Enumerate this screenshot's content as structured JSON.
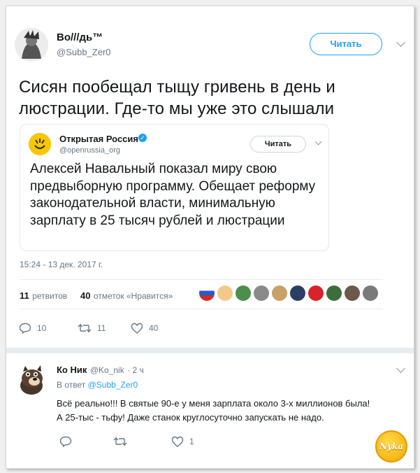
{
  "tweet": {
    "author_name": "Во///дь™",
    "author_handle": "@Subb_Zer0",
    "follow_label": "Читать",
    "text": "Сисян пообещал тыщу гривень в день и люстрации. Где-то мы уже это слышали",
    "timestamp": "15:24 - 13 дек. 2017 г.",
    "retweets_count": "11",
    "retweets_label": "ретвитов",
    "likes_count": "40",
    "likes_label": "отметок «Нравится»",
    "action_reply_count": "10",
    "action_retweet_count": "11",
    "action_like_count": "40"
  },
  "quoted": {
    "author_name": "Открытая Россия",
    "author_handle": "@openrussia_org",
    "follow_label": "Читать",
    "text": "Алексей Навальный показал миру свою предвыборную программу. Обещает реформу законодательной власти, минимальную зарплату в 25 тысяч рублей и люстрации"
  },
  "reply": {
    "author_name": "Ко Ник",
    "author_handle": "@Ko_nik",
    "age": "· 2 ч",
    "in_reply_prefix": "В ответ",
    "in_reply_handle": "@Subb_Zer0",
    "line1": "Всё реально!!! В святые 90-е у меня зарплата около 3-х миллионов была!",
    "line2": "А 25-тыс - тьфу! Даже станок круглосуточно запускать не надо.",
    "like_count": "1"
  },
  "watermark": "Nyka",
  "colors": {
    "accent": "#1da1f2",
    "muted": "#657786",
    "border": "#e1e8ed",
    "brand_yellow": "#f5c800"
  },
  "icons": [
    "chevron-down-icon",
    "verified-icon",
    "reply-icon",
    "retweet-icon",
    "like-icon"
  ]
}
